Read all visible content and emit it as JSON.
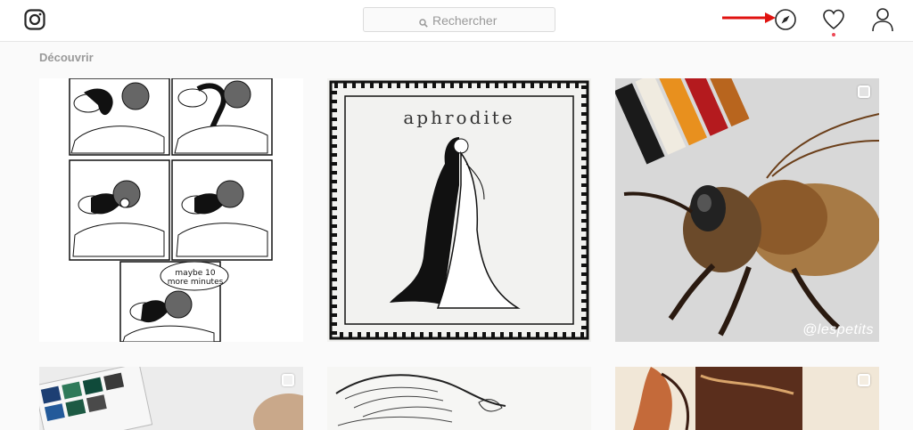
{
  "search": {
    "placeholder": "Rechercher"
  },
  "section": {
    "title": "Découvrir"
  },
  "posts": [
    {
      "id": "post-1",
      "subject": "comic",
      "bubble": "maybe 10 more minutes"
    },
    {
      "id": "post-2",
      "subject": "aphrodite",
      "title": "aphrodite"
    },
    {
      "id": "post-3",
      "subject": "bee",
      "watermark": "@lespetits"
    },
    {
      "id": "post-4",
      "subject": "watercolor"
    },
    {
      "id": "post-5",
      "subject": "sketch"
    },
    {
      "id": "post-6",
      "subject": "illustration"
    }
  ],
  "icons": {
    "logo": "instagram-logo-icon",
    "search": "search-icon",
    "explore": "compass-icon",
    "activity": "heart-icon",
    "profile": "person-icon"
  },
  "colors": {
    "notification_dot": "#ed4956",
    "annotation_arrow": "#e0120f"
  }
}
